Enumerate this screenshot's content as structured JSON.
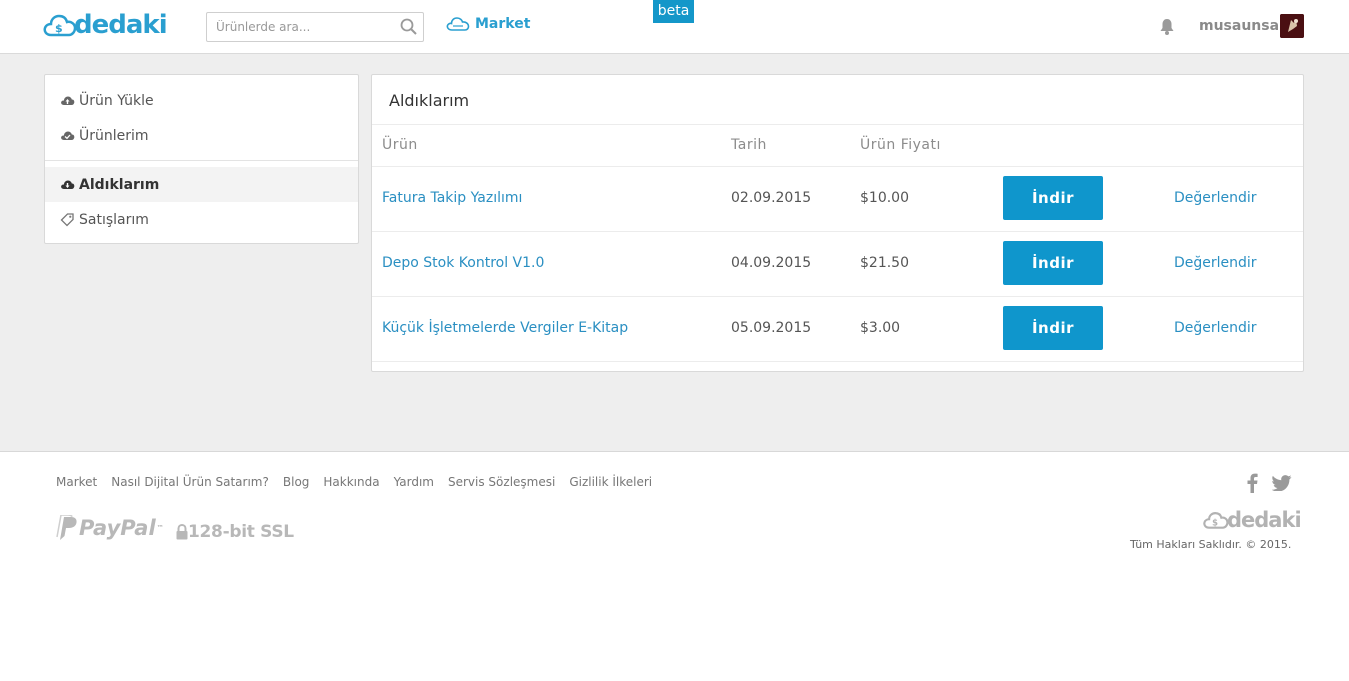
{
  "header": {
    "logo_text": "dedaki",
    "search_placeholder": "Ürünlerde ara...",
    "market_label": "Market",
    "beta_label": "beta",
    "username": "musaunsal"
  },
  "sidebar": {
    "items": [
      {
        "label": "Ürün Yükle",
        "icon": "cloud-upload-icon"
      },
      {
        "label": "Ürünlerim",
        "icon": "cloud-check-icon"
      },
      {
        "label": "Aldıklarım",
        "icon": "cloud-download-icon"
      },
      {
        "label": "Satışlarım",
        "icon": "tag-icon"
      }
    ],
    "active_index": 2
  },
  "panel": {
    "title": "Aldıklarım",
    "columns": [
      "Ürün",
      "Tarih",
      "Ürün Fiyatı"
    ],
    "rows": [
      {
        "product": "Fatura Takip Yazılımı",
        "date": "02.09.2015",
        "price": "$10.00",
        "download_label": "İndir",
        "rate_label": "Değerlendir"
      },
      {
        "product": "Depo Stok Kontrol V1.0",
        "date": "04.09.2015",
        "price": "$21.50",
        "download_label": "İndir",
        "rate_label": "Değerlendir"
      },
      {
        "product": "Küçük İşletmelerde Vergiler E-Kitap",
        "date": "05.09.2015",
        "price": "$3.00",
        "download_label": "İndir",
        "rate_label": "Değerlendir"
      }
    ]
  },
  "footer": {
    "links": [
      "Market",
      "Nasıl Dijital Ürün Satarım?",
      "Blog",
      "Hakkında",
      "Yardım",
      "Servis Sözleşmesi",
      "Gizlilik İlkeleri"
    ],
    "paypal_text": "PayPal",
    "paypal_tm": "™",
    "ssl_text": "128-bit SSL",
    "logo_text": "dedaki",
    "copyright": "Tüm Hakları Saklıdır. © 2015."
  },
  "colors": {
    "brand": "#2a9fd0",
    "button": "#0f96cc",
    "link": "#2a8fc2",
    "page_bg": "#eeeeee"
  }
}
